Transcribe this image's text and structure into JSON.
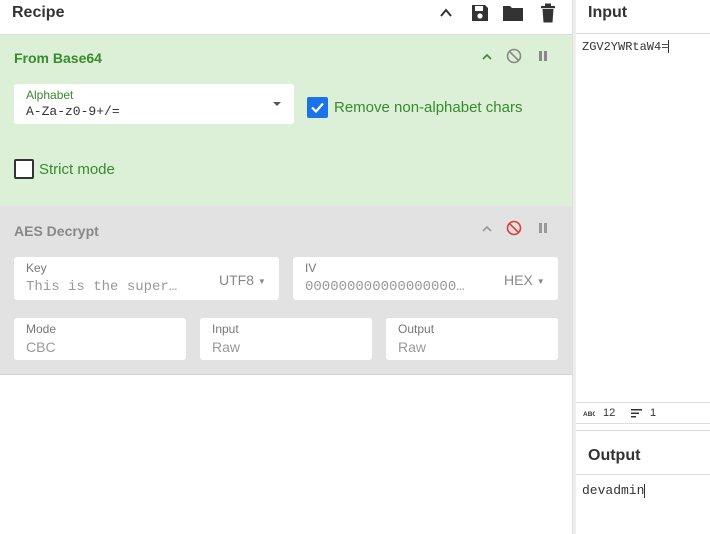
{
  "recipe": {
    "title": "Recipe",
    "operations": [
      {
        "name": "From Base64",
        "alphabet_label": "Alphabet",
        "alphabet_value": "A-Za-z0-9+/=",
        "remove_label": "Remove non-alphabet chars",
        "remove_checked": true,
        "strict_label": "Strict mode",
        "strict_checked": false
      },
      {
        "name": "AES Decrypt",
        "disabled": true,
        "key_label": "Key",
        "key_value": "This is the super…",
        "key_encoding": "UTF8",
        "iv_label": "IV",
        "iv_value": "000000000000000000…",
        "iv_encoding": "HEX",
        "mode_label": "Mode",
        "mode_value": "CBC",
        "input_label": "Input",
        "input_value": "Raw",
        "output_label": "Output",
        "output_value": "Raw"
      }
    ]
  },
  "input": {
    "title": "Input",
    "text": "ZGV2YWRtaW4=",
    "stats": {
      "length_icon": "abc-icon",
      "length": "12",
      "lines_icon": "lines-icon",
      "lines": "1"
    }
  },
  "output": {
    "title": "Output",
    "text": "devadmin"
  },
  "colors": {
    "green_bg": "#dbf0d6",
    "green_text": "#3a8a2e",
    "disabled_bg": "#e2e2e2",
    "checkbox_blue": "#1a73e8",
    "disable_red": "#e53935"
  }
}
